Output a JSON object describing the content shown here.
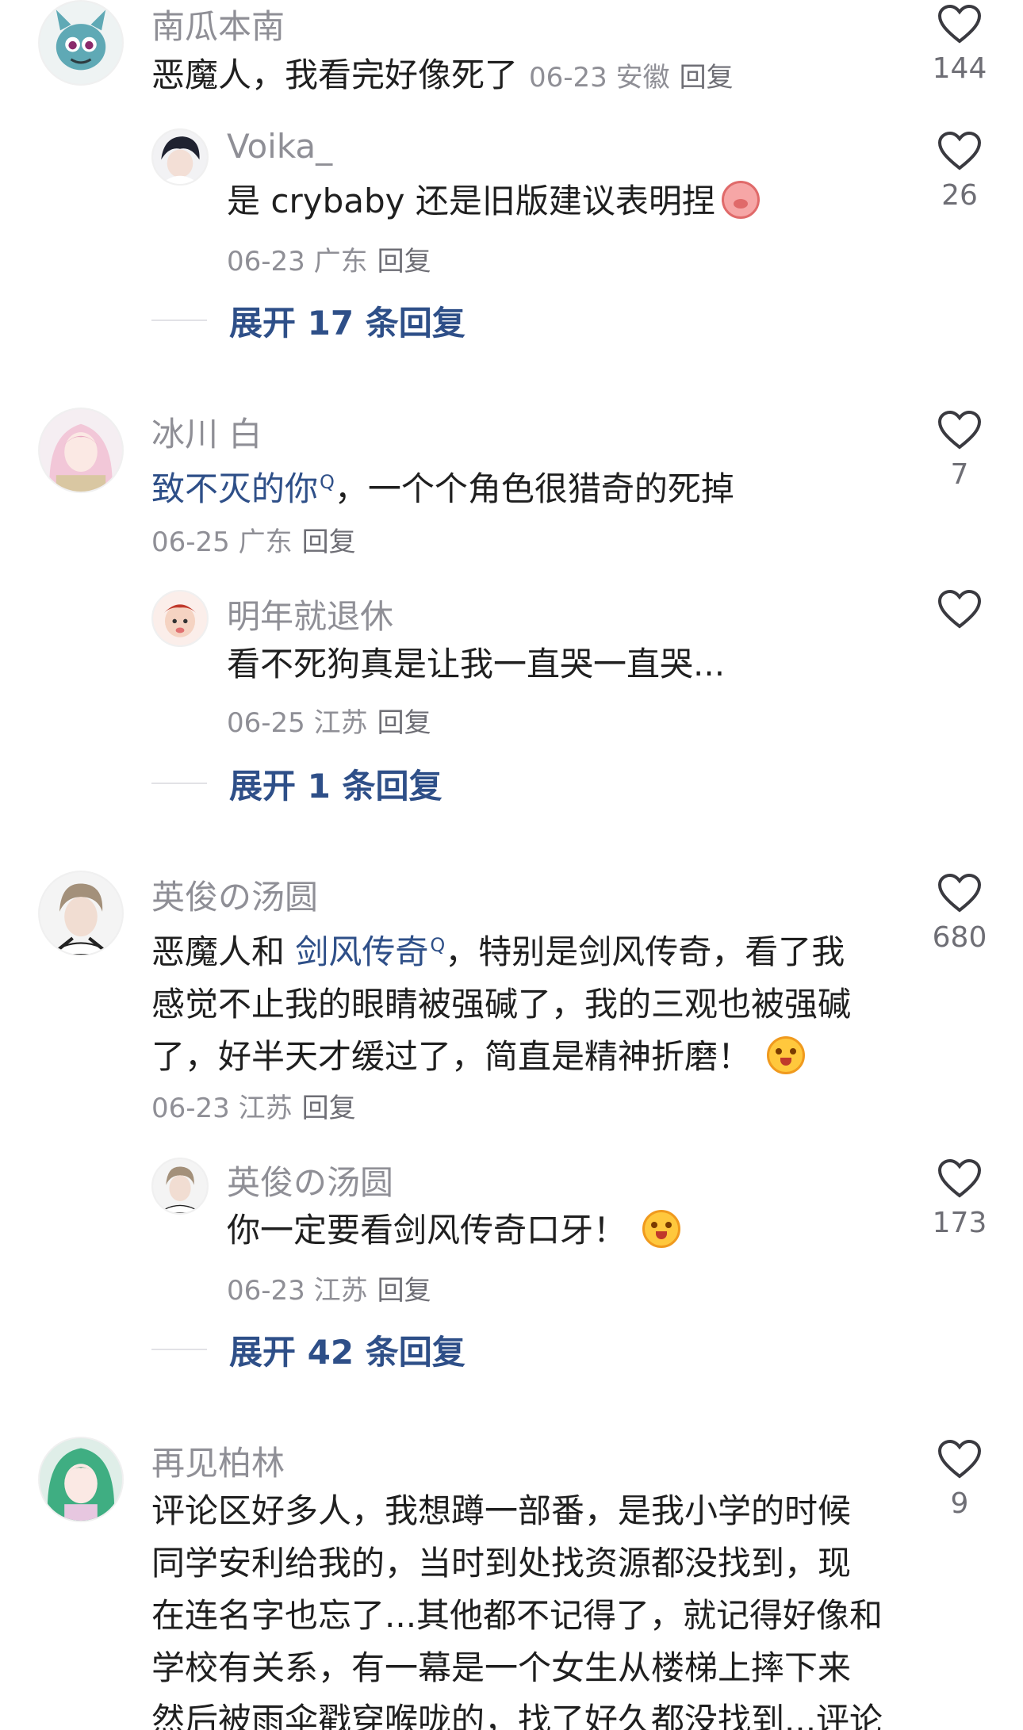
{
  "comments": [
    {
      "user": "南瓜本南",
      "text": "恶魔人，我看完好像死了",
      "date": "06-23 安徽",
      "reply_label": "回复",
      "likes": "144",
      "avatar": "teal-monster-avatar",
      "subreply": {
        "user": "Voika_",
        "text": "是 crybaby 还是旧版建议表明捏",
        "emoji": "pig-emoji",
        "meta": "06-23 广东",
        "reply_label": "回复",
        "likes": "26"
      },
      "expand_label": "展开 17 条回复"
    },
    {
      "user": "冰川 白",
      "link_text": "致不灭的你",
      "link_sup": "Q",
      "text_after": "，一个个角色很猎奇的死掉",
      "meta": "06-25 广东",
      "reply_label": "回复",
      "likes": "7",
      "subreply": {
        "user": "明年就退休",
        "text": "看不死狗真是让我一直哭一直哭...",
        "meta": "06-25 江苏",
        "reply_label": "回复",
        "likes": ""
      },
      "expand_label": "展开 1 条回复"
    },
    {
      "user": "英俊の汤圆",
      "text_before": "恶魔人和 ",
      "link_text": "剑风传奇",
      "link_sup": "Q",
      "line1_after": "，特别是剑风传奇，看了我",
      "line2": "感觉不止我的眼睛被强碱了，我的三观也被强碱",
      "line3": "了，好半天才缓过了，简直是精神折磨！",
      "meta": "06-23 江苏",
      "reply_label": "回复",
      "likes": "680",
      "subreply": {
        "user": "英俊の汤圆",
        "text": "你一定要看剑风传奇口牙！",
        "meta": "06-23 江苏",
        "reply_label": "回复",
        "likes": "173"
      },
      "expand_label": "展开 42 条回复"
    },
    {
      "user": "再见柏林",
      "lines": [
        "评论区好多人，我想蹲一部番，是我小学的时候",
        "同学安利给我的，当时到处找资源都没找到，现",
        "在连名字也忘了...其他都不记得了，就记得好像和",
        "学校有关系，有一幕是一个女生从楼梯上摔下来",
        "然后被雨伞戳穿喉咙的，找了好久都没找到...评论"
      ],
      "likes": "9"
    }
  ],
  "colors": {
    "username": "#8f8f96",
    "link": "#2e4f88",
    "text": "#1f1f1f"
  }
}
